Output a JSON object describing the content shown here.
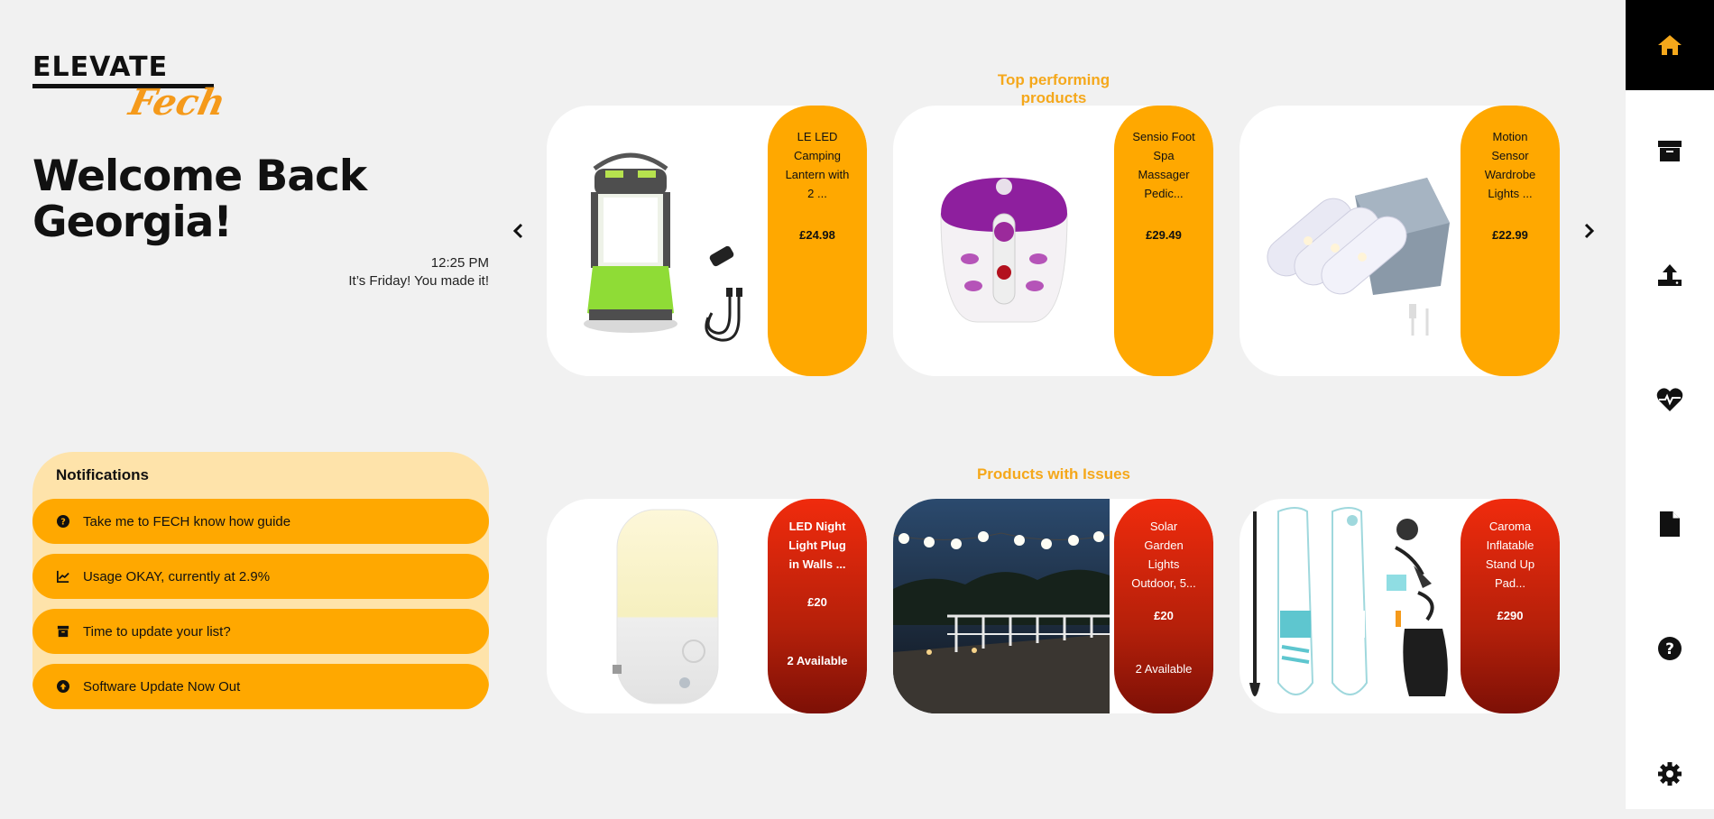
{
  "logo": {
    "top": "ELEVATE",
    "script": "Fech"
  },
  "welcome": {
    "line1": "Welcome Back",
    "line2": "Georgia!"
  },
  "clock": {
    "time": "12:25 PM",
    "message": "It’s Friday! You made it!"
  },
  "notifications": {
    "title": "Notifications",
    "items": [
      {
        "icon": "question-circle-icon",
        "text": "Take me to FECH know how guide"
      },
      {
        "icon": "line-chart-icon",
        "text": "Usage OKAY, currently at 2.9%"
      },
      {
        "icon": "archive-icon",
        "text": "Time to update your list?"
      },
      {
        "icon": "arrow-up-circle-icon",
        "text": "Software Update Now Out"
      }
    ]
  },
  "top_products": {
    "title": "Top performing products",
    "items": [
      {
        "name": "LE LED Camping Lantern with 2 ...",
        "price": "£24.98",
        "image": "camping-lantern"
      },
      {
        "name": "Sensio Foot Spa Massager Pedic...",
        "price": "£29.49",
        "image": "foot-spa"
      },
      {
        "name": "Motion Sensor Wardrobe Lights ...",
        "price": "£22.99",
        "image": "wardrobe-lights"
      }
    ]
  },
  "issue_products": {
    "title": "Products with Issues",
    "items": [
      {
        "name": "LED Night Light Plug in Walls ...",
        "price": "£20",
        "availability": "2 Available",
        "image": "night-light"
      },
      {
        "name": "Solar Garden Lights Outdoor, 5...",
        "price": "£20",
        "availability": "2 Available",
        "image": "garden-lights-photo"
      },
      {
        "name": "Caroma Inflatable Stand Up Pad...",
        "price": "£290",
        "availability": "",
        "image": "paddle-board-kit"
      }
    ]
  },
  "sidebar": {
    "items": [
      "home-icon",
      "archive-icon",
      "upload-icon",
      "heartbeat-icon",
      "document-icon",
      "help-icon",
      "settings-icon"
    ],
    "active_color": "#f5a81b"
  },
  "colors": {
    "accent": "#ffa800",
    "issue_red": "#e0280c",
    "panel": "#fee3aa"
  }
}
